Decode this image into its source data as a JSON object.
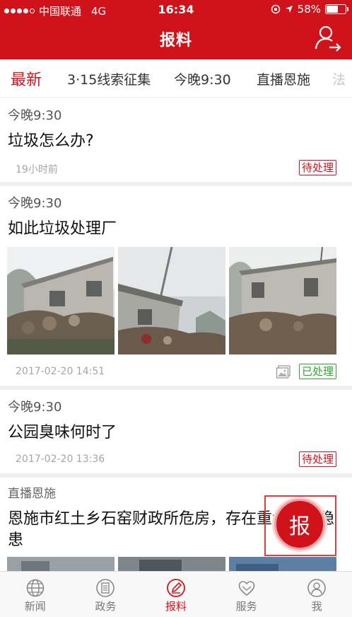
{
  "status_bar": {
    "carrier": "中国联通",
    "network": "4G",
    "time": "16:34",
    "battery": "58%"
  },
  "header": {
    "title": "报料",
    "login_icon": "user-arrow-icon"
  },
  "tabs": [
    {
      "label": "最新",
      "active": true
    },
    {
      "label": "3·15线索征集"
    },
    {
      "label": "今晚9:30"
    },
    {
      "label": "直播恩施"
    },
    {
      "label": "法"
    }
  ],
  "feed": [
    {
      "source": "今晚9:30",
      "title": "垃圾怎么办?",
      "time": "19小时前",
      "status": "待处理"
    },
    {
      "source": "今晚9:30",
      "title": "如此垃圾处理厂",
      "time": "2017-02-20 14:51",
      "status": "已处理",
      "has_gallery": true
    },
    {
      "source": "今晚9:30",
      "title": "公园臭味何时了",
      "time": "2017-02-20 13:36",
      "status": "待处理"
    },
    {
      "source": "直播恩施",
      "title": "恩施市红土乡石窑财政所危房，存在重大安全隐患"
    }
  ],
  "fab": {
    "label": "报"
  },
  "tabbar": [
    {
      "label": "新闻",
      "icon": "globe-icon"
    },
    {
      "label": "政务",
      "icon": "document-icon"
    },
    {
      "label": "报料",
      "icon": "pencil-icon",
      "active": true
    },
    {
      "label": "服务",
      "icon": "heart-hands-icon"
    },
    {
      "label": "我",
      "icon": "person-icon"
    }
  ],
  "colors": {
    "brand": "#d0121b",
    "done": "#2aa52a"
  }
}
